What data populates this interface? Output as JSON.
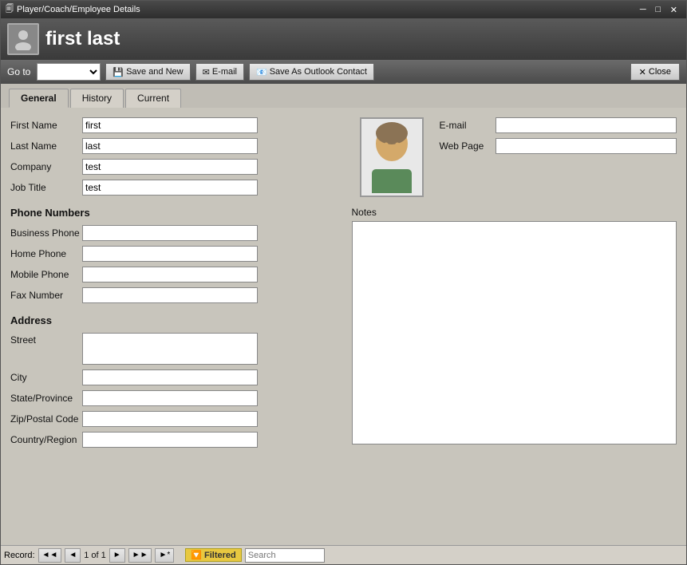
{
  "titlebar": {
    "title": "Player/Coach/Employee Details",
    "min_btn": "─",
    "restore_btn": "□",
    "close_btn": "✕"
  },
  "header": {
    "icon_label": "person-icon",
    "title": "first last"
  },
  "toolbar": {
    "goto_label": "Go to",
    "goto_placeholder": "",
    "save_new_label": "Save and New",
    "email_label": "E-mail",
    "save_outlook_label": "Save As Outlook Contact",
    "close_label": "Close"
  },
  "tabs": [
    {
      "id": "general",
      "label": "General",
      "active": true
    },
    {
      "id": "history",
      "label": "History",
      "active": false
    },
    {
      "id": "current",
      "label": "Current",
      "active": false
    }
  ],
  "form": {
    "personal": {
      "first_name_label": "First Name",
      "first_name_value": "first",
      "last_name_label": "Last Name",
      "last_name_value": "last",
      "company_label": "Company",
      "company_value": "test",
      "job_title_label": "Job Title",
      "job_title_value": "test"
    },
    "contact": {
      "email_label": "E-mail",
      "email_value": "",
      "web_page_label": "Web Page",
      "web_page_value": ""
    },
    "phone_numbers": {
      "heading": "Phone Numbers",
      "business_phone_label": "Business Phone",
      "business_phone_value": "",
      "home_phone_label": "Home Phone",
      "home_phone_value": "",
      "mobile_phone_label": "Mobile Phone",
      "mobile_phone_value": "",
      "fax_number_label": "Fax Number",
      "fax_number_value": ""
    },
    "address": {
      "heading": "Address",
      "street_label": "Street",
      "street_value": "",
      "city_label": "City",
      "city_value": "",
      "state_label": "State/Province",
      "state_value": "",
      "zip_label": "Zip/Postal Code",
      "zip_value": "",
      "country_label": "Country/Region",
      "country_value": ""
    },
    "notes": {
      "label": "Notes",
      "value": ""
    }
  },
  "statusbar": {
    "record_label": "Record:",
    "first_btn": "◄◄",
    "prev_btn": "◄",
    "record_info": "1 of 1",
    "next_btn": "►",
    "last_btn": "►►",
    "new_btn": "►*",
    "filtered_label": "Filtered",
    "search_label": "Search",
    "search_value": ""
  },
  "icons": {
    "save_icon": "💾",
    "email_icon": "✉",
    "outlook_icon": "📧",
    "close_icon": "✕",
    "filter_icon": "🔽"
  }
}
